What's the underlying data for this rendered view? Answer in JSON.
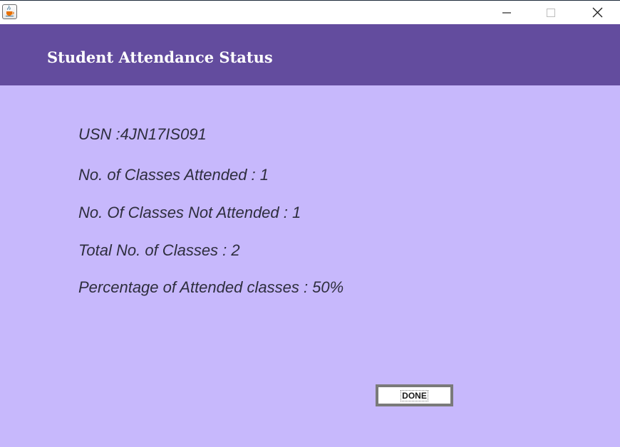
{
  "window": {
    "controls": {
      "minimize": "minimize-icon",
      "maximize": "maximize-icon",
      "close": "close-icon"
    },
    "app_icon": "java-cup-icon"
  },
  "header": {
    "title": "Student Attendance Status",
    "background": "#634c9e",
    "text_color": "#ffffff"
  },
  "content": {
    "background": "#c7b8fc",
    "usn_line": "USN :4JN17IS091",
    "attended_line": "No. of Classes Attended : 1",
    "not_attended_line": "No. Of Classes Not Attended : 1",
    "total_line": "Total No. of Classes : 2",
    "percentage_line": "Percentage of Attended classes : 50%"
  },
  "actions": {
    "done_label": "DONE"
  }
}
